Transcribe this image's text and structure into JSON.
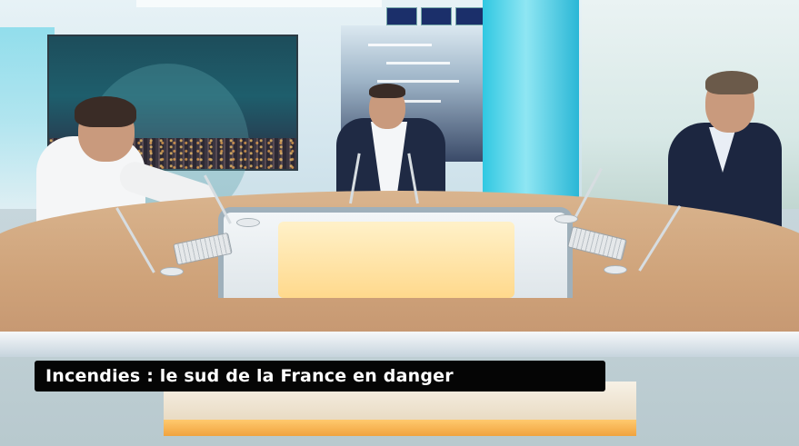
{
  "caption": {
    "headline": "Incendies : le sud de la France en danger"
  },
  "scene": {
    "description_tags": [
      "tv-studio",
      "three-presenters",
      "news-desk"
    ],
    "colors": {
      "caption_background": "#050505",
      "caption_text": "#ffffff",
      "accent_cyan": "#30c8e2",
      "desk_wood": "#d9b48e"
    }
  }
}
